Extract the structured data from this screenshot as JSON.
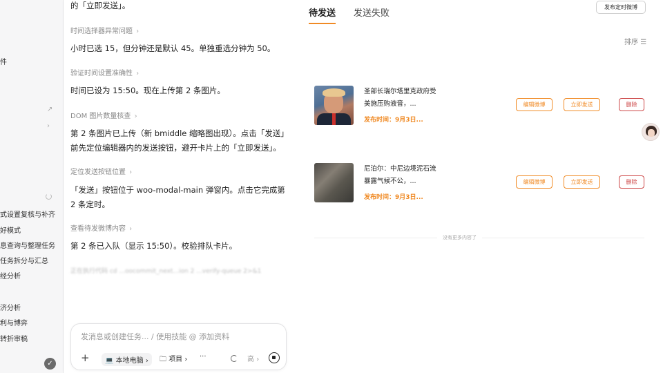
{
  "sidebar": {
    "items": [
      "件",
      "式设置复核与补齐",
      "好模式",
      "息查询与整理任务",
      "任务拆分与汇总",
      "经分析",
      "济分析",
      "利与博弈",
      "转折审稿"
    ]
  },
  "chat": {
    "messages": [
      "的「立即发送」。",
      "小时已选 15，但分钟还是默认 45。单独重选分钟为 50。",
      "时间已设为 15:50。现在上传第 2 条图片。",
      "第 2 条图片已上传（新 bmiddle 缩略图出现）。点击「发送」前先定位编辑器内的发送按钮，避开卡片上的「立即发送」。",
      "「发送」按钮位于 woo-modal-main 弹窗内。点击它完成第 2 条定时。",
      "第 2 条已入队（显示 15:50）。校验排队卡片。"
    ],
    "steps": [
      "时间选择器异常问题",
      "验证时间设置准确性",
      "DOM 图片数量核查",
      "定位发送按钮位置",
      "查看待发微博内容"
    ],
    "faded_line": "正在执行代码 cd ...oocommit_next...ion 2 ...verify-queue 2>&1"
  },
  "composer": {
    "placeholder": "发消息或创建任务... / 使用技能 @ 添加资料",
    "local_label": "本地电脑",
    "project_label": "项目",
    "more": "···",
    "model_label": "高"
  },
  "app": {
    "tabs": [
      "待发送",
      "发送失败"
    ],
    "schedule_button": "发布定时微博",
    "sort_label": "排序",
    "cards": [
      {
        "title": "圣部长瑞尔塔里克政府受美施压购液音，...",
        "time": "发布时间：9月3日...",
        "edit": "编辑微博",
        "send": "立即发送",
        "delete": "删除"
      },
      {
        "title": "尼泊尔：中尼边境泥石流暴露气候不公，...",
        "time": "发布时间：9月3日...",
        "edit": "编辑微博",
        "send": "立即发送",
        "delete": "删除"
      }
    ],
    "no_more": "没有更多内容了"
  }
}
